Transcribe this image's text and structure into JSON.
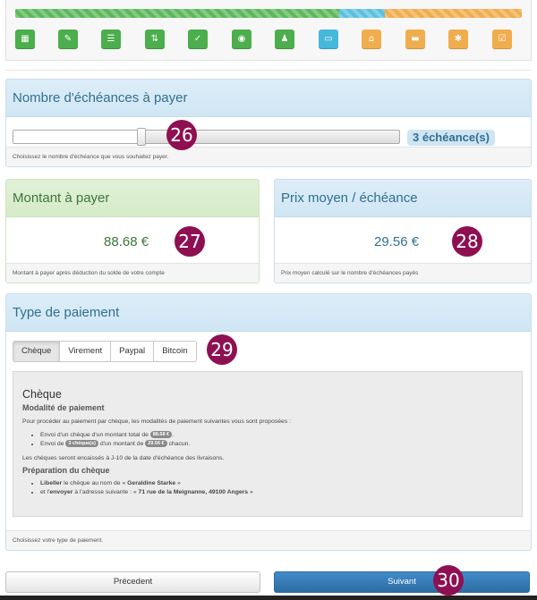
{
  "progress": {
    "segments": [
      {
        "color": "#5cb85c",
        "fraction": 0.64
      },
      {
        "color": "#5bc0de",
        "fraction": 0.09
      },
      {
        "color": "#f0ad4e",
        "fraction": 0.27
      }
    ]
  },
  "steps": [
    {
      "icon": "grid-icon",
      "glyph": "▦",
      "color": "green"
    },
    {
      "icon": "wrench-icon",
      "glyph": "✎",
      "color": "green"
    },
    {
      "icon": "list-icon",
      "glyph": "☰",
      "color": "green"
    },
    {
      "icon": "sort-icon",
      "glyph": "⇅",
      "color": "green"
    },
    {
      "icon": "check-icon",
      "glyph": "✓",
      "color": "green"
    },
    {
      "icon": "eye-icon",
      "glyph": "◉",
      "color": "green"
    },
    {
      "icon": "user-icon",
      "glyph": "♟",
      "color": "green"
    },
    {
      "icon": "card-icon",
      "glyph": "▭",
      "color": "blue"
    },
    {
      "icon": "home-icon",
      "glyph": "⌂",
      "color": "orange"
    },
    {
      "icon": "comment-icon",
      "glyph": "▬",
      "color": "orange"
    },
    {
      "icon": "asterisk-icon",
      "glyph": "✱",
      "color": "orange"
    },
    {
      "icon": "check-square-icon",
      "glyph": "☑",
      "color": "orange"
    }
  ],
  "echeances": {
    "title": "Nombre d'échéances à payer",
    "slider_fraction": 0.33,
    "badge": "3 échéance(s)",
    "footer": "Choisissez le nombre d'échéance que vous souhaitez payer."
  },
  "montant": {
    "title": "Montant à payer",
    "value": "88.68 €",
    "footer": "Montant à payer après déduction du solde de votre compte"
  },
  "prix_moyen": {
    "title": "Prix moyen / échéance",
    "value": "29.56 €",
    "footer": "Prix moyen calculé sur le nombre d'échéances payés"
  },
  "paiement": {
    "title": "Type de paiement",
    "tabs": [
      "Chèque",
      "Virement",
      "Paypal",
      "Bitcoin"
    ],
    "active_tab": "Chèque",
    "cheque": {
      "title": "Chèque",
      "modalite_title": "Modalité de paiement",
      "intro": "Pour procéder au paiement par chèque, les modalités de paiement suivantes vous sont proposées :",
      "item1_pre": "Envoi d'un chèque d'un montant total de",
      "item1_pill": "88.68 €",
      "item1_post": ".",
      "item2_pre": "Envoi de",
      "item2_pill": "3 chèque(s)",
      "item2_mid": "d'un montant de",
      "item2_pill2": "29.56 €",
      "item2_post": "chacun.",
      "encaisse": "Les chèques seront encaissés à J-10 de la date d'échéance des livraisons.",
      "prep_title": "Préparation du chèque",
      "prep1_bold": "Libeller",
      "prep1_text": "le chèque au nom de «",
      "prep1_name": "Geraldine Starke",
      "prep1_end": "»",
      "prep2_pre": "et l'",
      "prep2_bold": "envoyer",
      "prep2_text": "à l'adresse suivante : «",
      "prep2_addr": "71 rue de la Meignanne, 49100 Angers",
      "prep2_end": "»"
    },
    "footer": "Choisissez votre type de paiement."
  },
  "buttons": {
    "prev": "Précedent",
    "next": "Suivant"
  },
  "markers": [
    "26",
    "27",
    "28",
    "29",
    "30"
  ]
}
